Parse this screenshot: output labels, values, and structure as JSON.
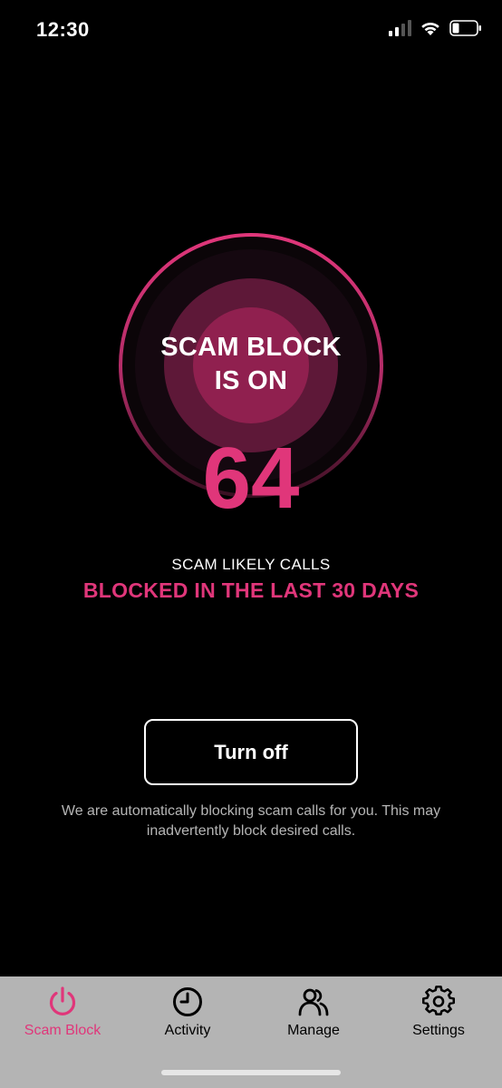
{
  "status_bar": {
    "time": "12:30",
    "icons": [
      "cellular-signal-icon",
      "wifi-icon",
      "battery-icon"
    ]
  },
  "dial": {
    "title_line1": "SCAM BLOCK",
    "title_line2": "IS ON",
    "count": "64"
  },
  "caption": "SCAM LIKELY CALLS",
  "subcaption": "BLOCKED IN THE LAST 30 DAYS",
  "turn_off_label": "Turn off",
  "disclaimer": "We are automatically blocking scam calls for you. This may inadvertently block desired calls.",
  "tabs": [
    {
      "label": "Scam Block",
      "icon": "power-icon",
      "active": true
    },
    {
      "label": "Activity",
      "icon": "clock-icon",
      "active": false
    },
    {
      "label": "Manage",
      "icon": "people-icon",
      "active": false
    },
    {
      "label": "Settings",
      "icon": "gear-icon",
      "active": false
    }
  ],
  "colors": {
    "accent": "#e0367a",
    "background": "#000000",
    "tab_bar": "#b4b4b4"
  }
}
